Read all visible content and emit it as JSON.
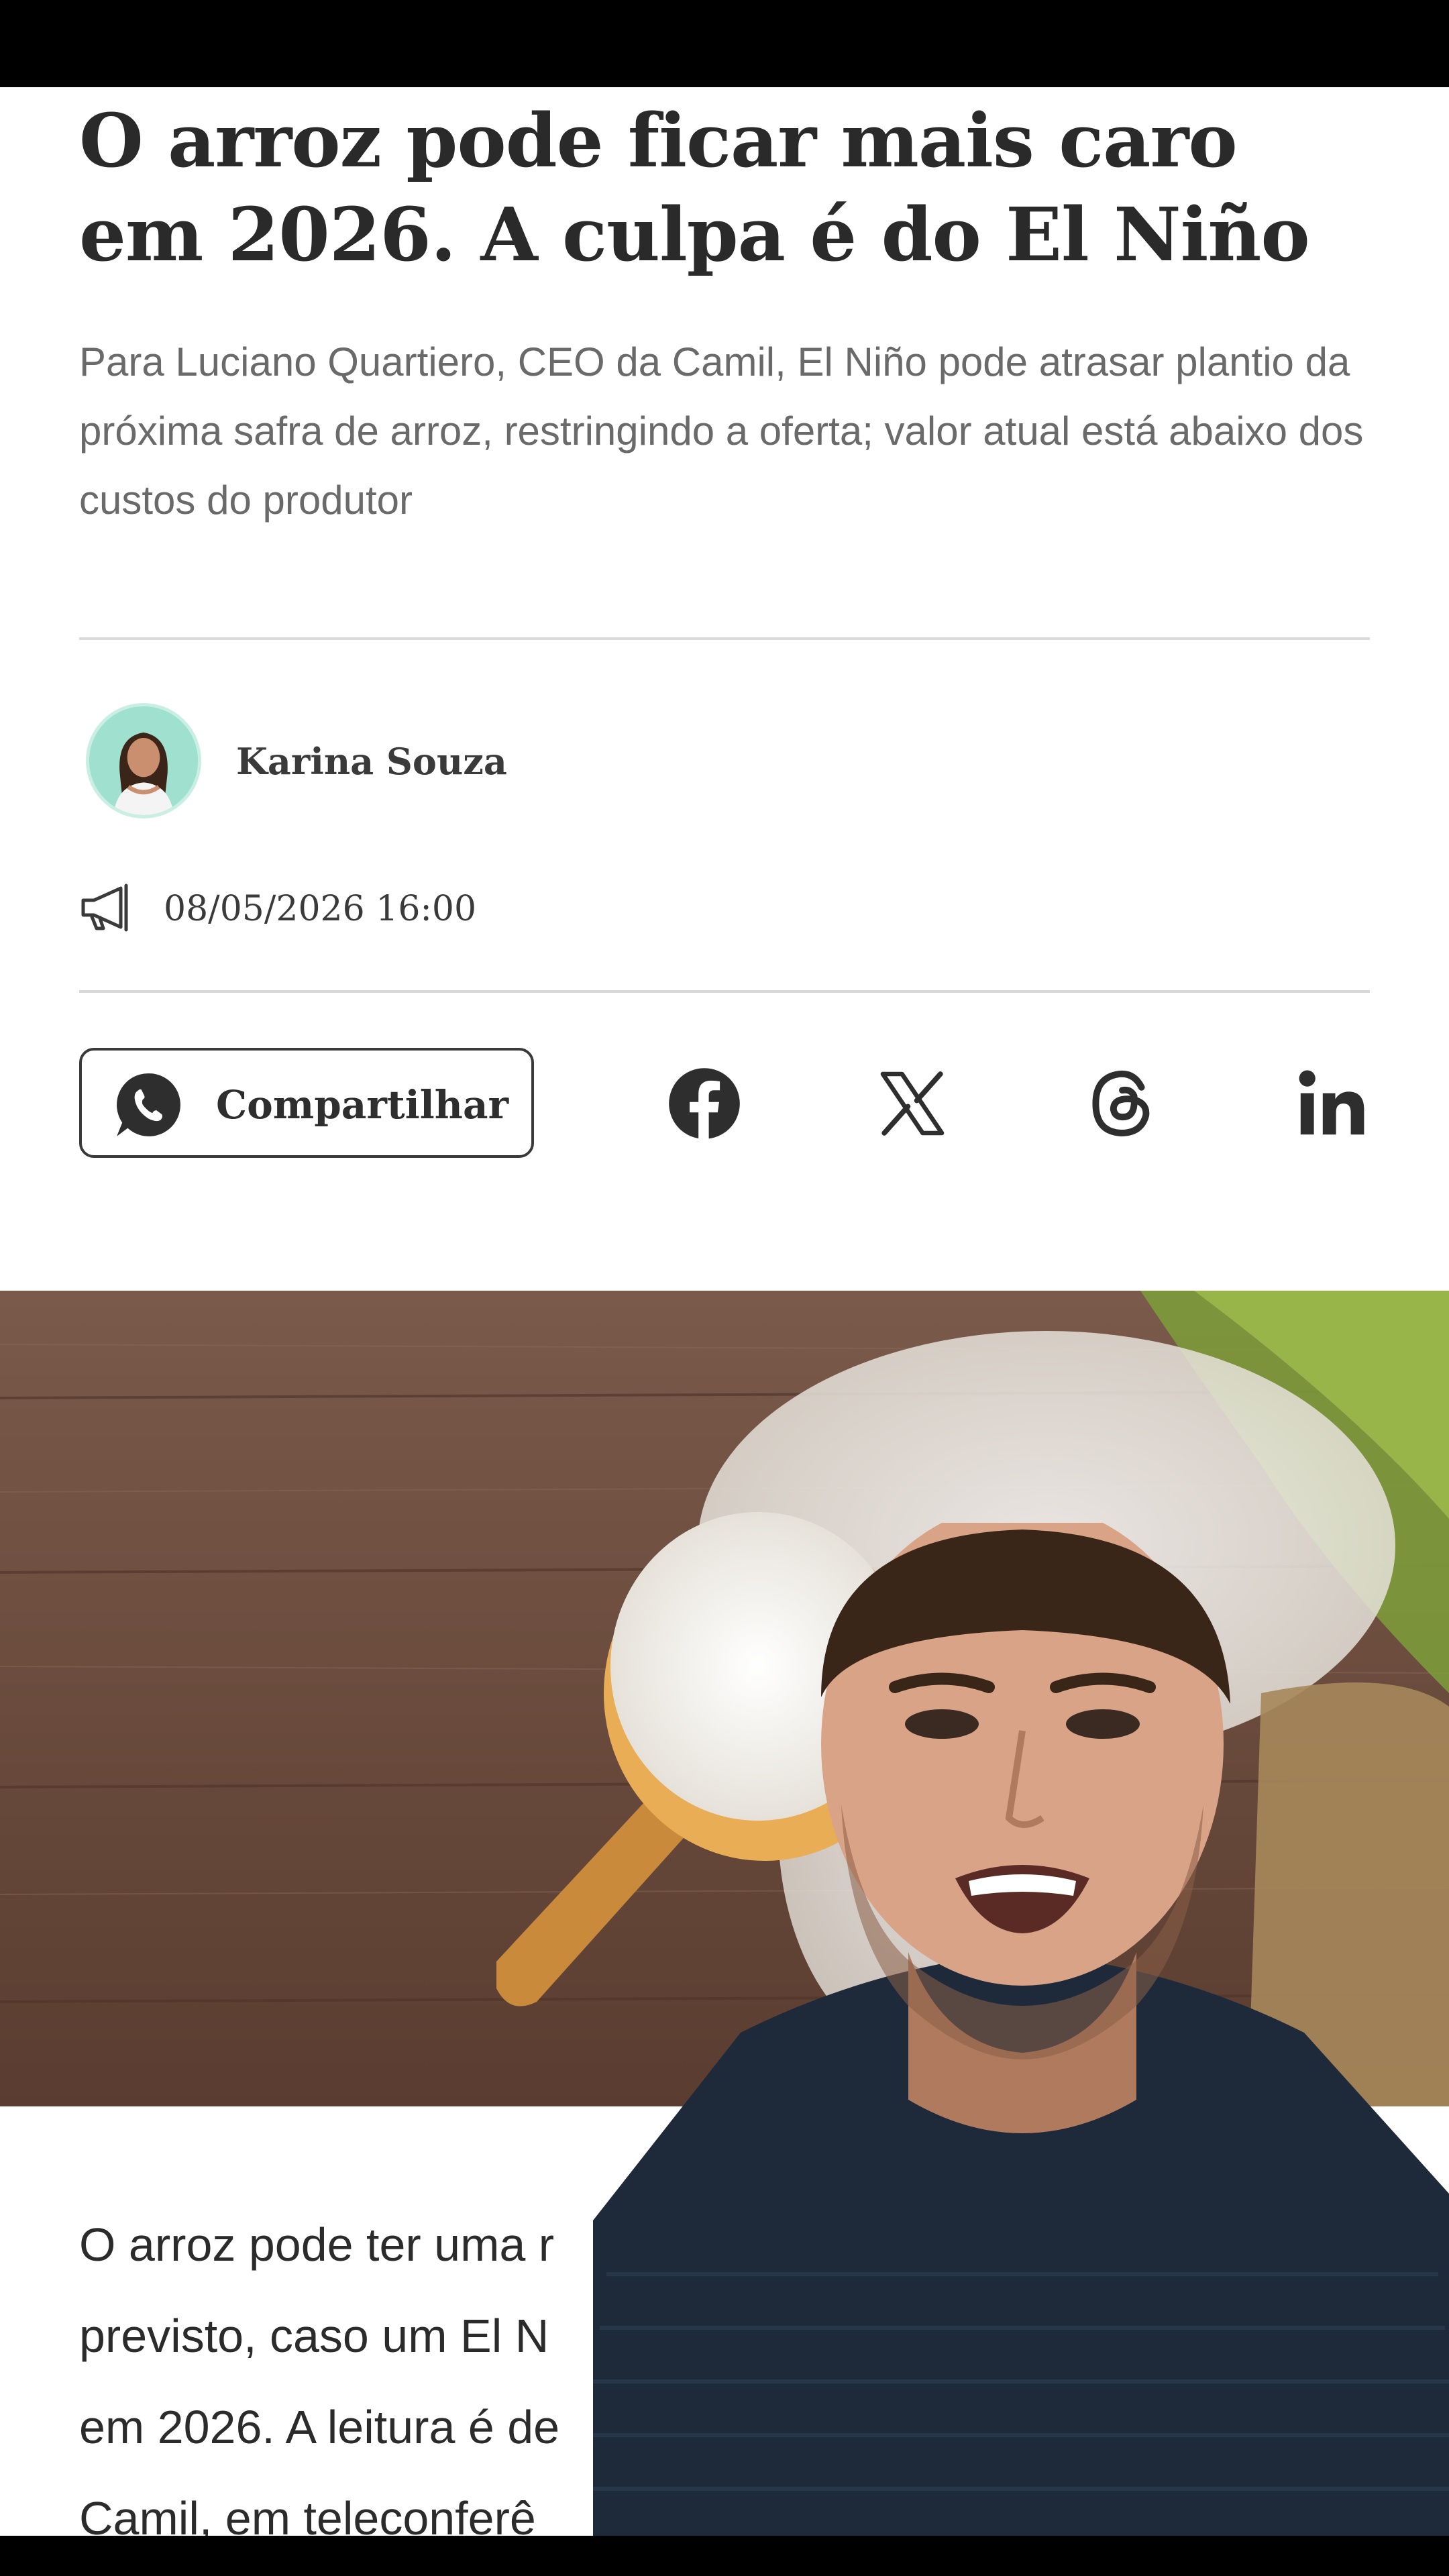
{
  "article": {
    "headline": "O arroz pode ficar mais caro em 2026. A culpa é do El Niño",
    "subtitle": "Para Luciano Quartiero, CEO da Camil, El Niño pode atrasar plantio da próxima safra de arroz, restringindo a oferta; valor atual está abaixo dos custos do produtor",
    "author": "Karina Souza",
    "date": "08/05/2026 16:00",
    "body_lines": [
      "O arroz pode ter uma r",
      "previsto, caso um El N",
      "em 2026. A leitura é de",
      "Camil, em teleconferê"
    ]
  },
  "share": {
    "whatsapp_label": "Compartilhar",
    "icons": [
      "whatsapp-icon",
      "facebook-icon",
      "x-icon",
      "threads-icon",
      "linkedin-icon"
    ]
  },
  "colors": {
    "headline": "#2a2a2a",
    "subtitle": "#6a6a6a",
    "divider": "#d9d9d9",
    "avatar_bg": "#9fe0cf",
    "bars": "#000000"
  }
}
